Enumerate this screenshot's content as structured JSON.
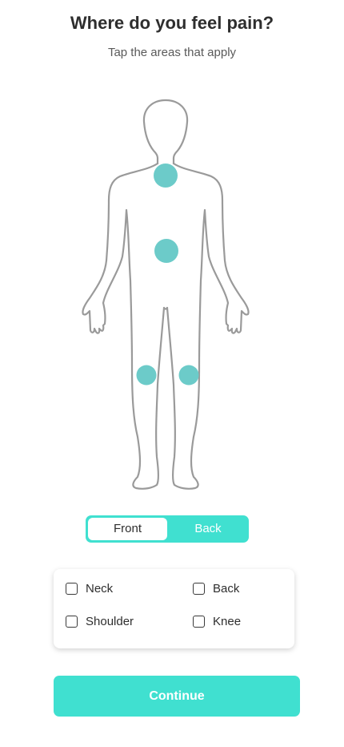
{
  "header": {
    "title": "Where do you feel pain?",
    "subtitle": "Tap the areas that apply"
  },
  "body_map": {
    "view": "front",
    "outline_icon": "human-body-outline-icon",
    "marker_color": "#6ccbc9",
    "markers": [
      "neck",
      "abdomen",
      "left-knee",
      "right-knee"
    ]
  },
  "view_toggle": {
    "front_label": "Front",
    "back_label": "Back",
    "selected": "Front",
    "accent_color": "#40e0d0"
  },
  "areas": {
    "options": [
      {
        "label": "Neck",
        "checked": false
      },
      {
        "label": "Back",
        "checked": false
      },
      {
        "label": "Shoulder",
        "checked": false
      },
      {
        "label": "Knee",
        "checked": false
      }
    ]
  },
  "footer": {
    "continue_label": "Continue",
    "button_color": "#40e0d0"
  }
}
